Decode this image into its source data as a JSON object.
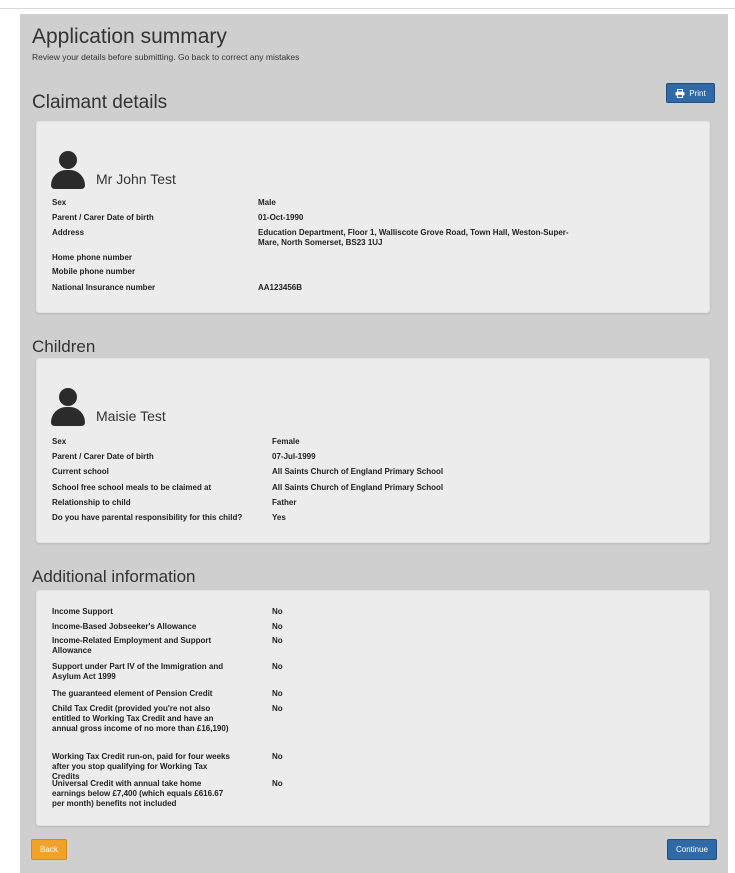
{
  "header": {
    "title": "Application summary",
    "subtitle": "Review your details before submitting. Go back to correct any mistakes"
  },
  "print_button": {
    "label": "Print",
    "icon": "printer-icon"
  },
  "claimant": {
    "heading": "Claimant details",
    "name": "Mr John Test",
    "fields": [
      {
        "label": "Sex",
        "value": "Male"
      },
      {
        "label": "Parent / Carer Date of birth",
        "value": "01-Oct-1990"
      },
      {
        "label": "Address",
        "value": "Education Department, Floor 1, Walliscote Grove Road, Town Hall, Weston-Super-Mare, North Somerset, BS23 1UJ"
      },
      {
        "label": "Home phone number",
        "value": ""
      },
      {
        "label": "Mobile phone number",
        "value": ""
      },
      {
        "label": "National Insurance number",
        "value": "AA123456B"
      }
    ]
  },
  "children": {
    "heading": "Children",
    "name": "Maisie Test",
    "fields": [
      {
        "label": "Sex",
        "value": "Female"
      },
      {
        "label": "Parent / Carer Date of birth",
        "value": "07-Jul-1999"
      },
      {
        "label": "Current school",
        "value": "All Saints Church of England Primary School"
      },
      {
        "label": "School free school meals to be claimed at",
        "value": "All Saints Church of England Primary School"
      },
      {
        "label": "Relationship to child",
        "value": "Father"
      },
      {
        "label": "Do you have parental responsibility for this child?",
        "value": "Yes"
      }
    ]
  },
  "additional": {
    "heading": "Additional information",
    "fields": [
      {
        "label": "Income Support",
        "value": "No"
      },
      {
        "label": "Income-Based Jobseeker's Allowance",
        "value": "No"
      },
      {
        "label": "Income-Related Employment and Support Allowance",
        "value": "No"
      },
      {
        "label": "Support under Part IV of the Immigration and Asylum Act 1999",
        "value": "No"
      },
      {
        "label": "The guaranteed element of Pension Credit",
        "value": "No"
      },
      {
        "label": "Child Tax Credit (provided you're not also entitled to Working Tax Credit and have an annual gross income of no more than £16,190)",
        "value": "No"
      },
      {
        "label": "Working Tax Credit run-on, paid for four weeks after you stop qualifying for Working Tax Credits",
        "value": "No"
      },
      {
        "label": "Universal Credit with annual take home earnings below £7,400 (which equals £616.67 per month) benefits not included",
        "value": "No"
      }
    ]
  },
  "buttons": {
    "back": "Back",
    "continue": "Continue"
  },
  "colors": {
    "primary": "#2f6aa6",
    "warning": "#f0a22a",
    "panel": "#cfcfcf",
    "card": "#ececec"
  }
}
